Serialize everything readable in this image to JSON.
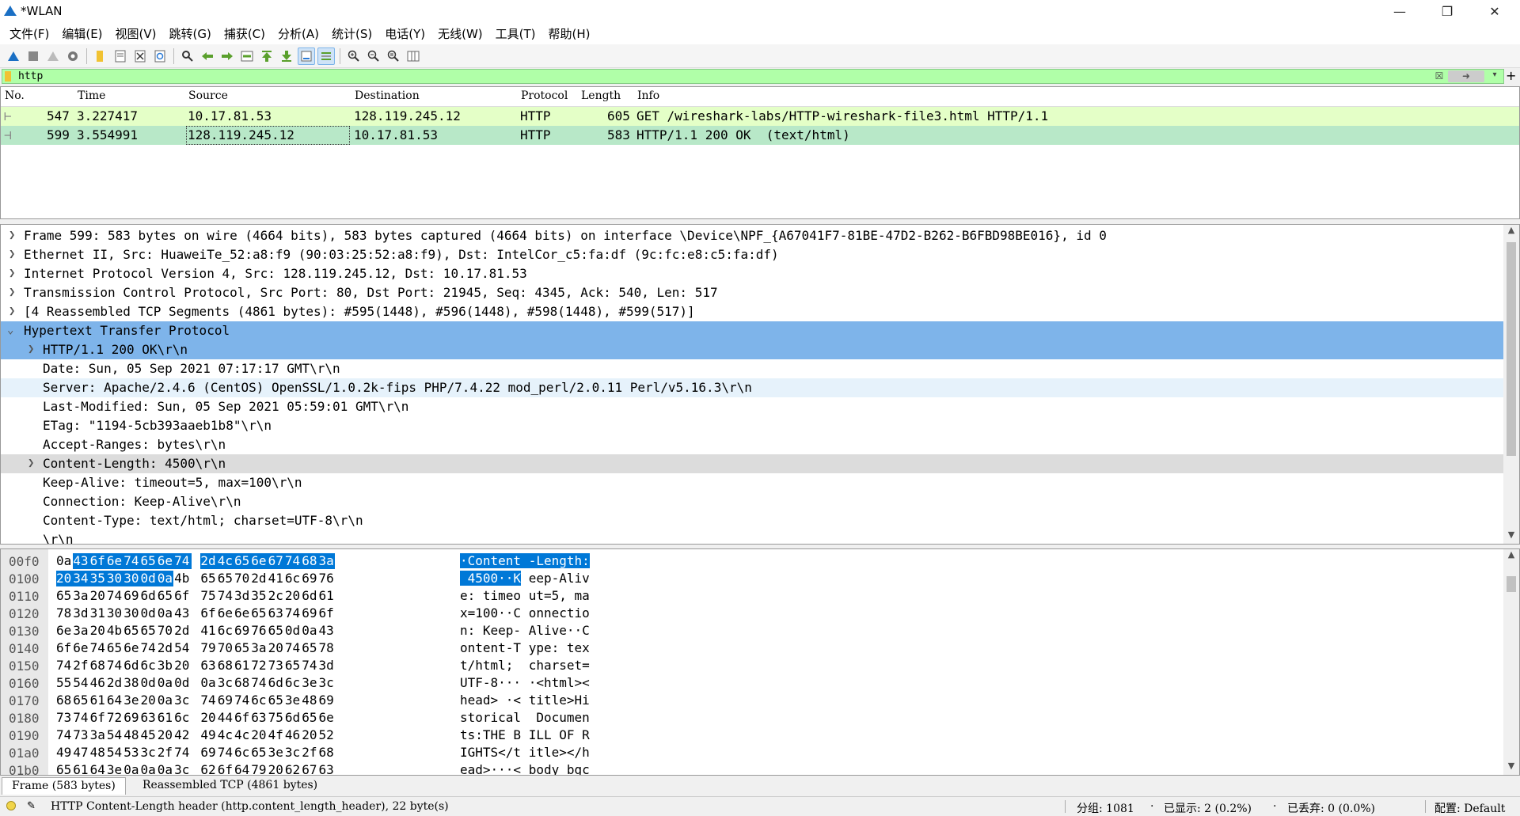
{
  "window": {
    "title": "*WLAN"
  },
  "menu": [
    "文件(F)",
    "编辑(E)",
    "视图(V)",
    "跳转(G)",
    "捕获(C)",
    "分析(A)",
    "统计(S)",
    "电话(Y)",
    "无线(W)",
    "工具(T)",
    "帮助(H)"
  ],
  "filter": {
    "value": "http"
  },
  "packet_list": {
    "columns": [
      "No.",
      "Time",
      "Source",
      "Destination",
      "Protocol",
      "Length",
      "Info"
    ],
    "rows": [
      {
        "no": "547",
        "time": "3.227417",
        "source": "10.17.81.53",
        "destination": "128.119.245.12",
        "protocol": "HTTP",
        "length": "605",
        "info": "GET /wireshark-labs/HTTP-wireshark-file3.html HTTP/1.1"
      },
      {
        "no": "599",
        "time": "3.554991",
        "source": "128.119.245.12",
        "destination": "10.17.81.53",
        "protocol": "HTTP",
        "length": "583",
        "info": "HTTP/1.1 200 OK  (text/html)"
      }
    ]
  },
  "details": [
    {
      "text": "Frame 599: 583 bytes on wire (4664 bits), 583 bytes captured (4664 bits) on interface \\Device\\NPF_{A67041F7-81BE-47D2-B262-B6FBD98BE016}, id 0"
    },
    {
      "text": "Ethernet II, Src: HuaweiTe_52:a8:f9 (90:03:25:52:a8:f9), Dst: IntelCor_c5:fa:df (9c:fc:e8:c5:fa:df)"
    },
    {
      "text": "Internet Protocol Version 4, Src: 128.119.245.12, Dst: 10.17.81.53"
    },
    {
      "text": "Transmission Control Protocol, Src Port: 80, Dst Port: 21945, Seq: 4345, Ack: 540, Len: 517"
    },
    {
      "text": "[4 Reassembled TCP Segments (4861 bytes): #595(1448), #596(1448), #598(1448), #599(517)]"
    },
    {
      "text": "Hypertext Transfer Protocol"
    },
    {
      "text": "HTTP/1.1 200 OK\\r\\n"
    },
    {
      "text": "Date: Sun, 05 Sep 2021 07:17:17 GMT\\r\\n"
    },
    {
      "text": "Server: Apache/2.4.6 (CentOS) OpenSSL/1.0.2k-fips PHP/7.4.22 mod_perl/2.0.11 Perl/v5.16.3\\r\\n"
    },
    {
      "text": "Last-Modified: Sun, 05 Sep 2021 05:59:01 GMT\\r\\n"
    },
    {
      "text": "ETag: \"1194-5cb393aaeb1b8\"\\r\\n"
    },
    {
      "text": "Accept-Ranges: bytes\\r\\n"
    },
    {
      "text": "Content-Length: 4500\\r\\n"
    },
    {
      "text": "Keep-Alive: timeout=5, max=100\\r\\n"
    },
    {
      "text": "Connection: Keep-Alive\\r\\n"
    },
    {
      "text": "Content-Type: text/html; charset=UTF-8\\r\\n"
    },
    {
      "text": "\\r\\n"
    }
  ],
  "hex": [
    {
      "off": "00f0",
      "bytes": [
        "0a",
        "43",
        "6f",
        "6e",
        "74",
        "65",
        "6e",
        "74",
        "2d",
        "4c",
        "65",
        "6e",
        "67",
        "74",
        "68",
        "3a"
      ],
      "ascii": "·Content -Length:"
    },
    {
      "off": "0100",
      "bytes": [
        "20",
        "34",
        "35",
        "30",
        "30",
        "0d",
        "0a",
        "4b",
        "65",
        "65",
        "70",
        "2d",
        "41",
        "6c",
        "69",
        "76"
      ],
      "ascii": " 4500··K eep-Aliv"
    },
    {
      "off": "0110",
      "bytes": [
        "65",
        "3a",
        "20",
        "74",
        "69",
        "6d",
        "65",
        "6f",
        "75",
        "74",
        "3d",
        "35",
        "2c",
        "20",
        "6d",
        "61"
      ],
      "ascii": "e: timeo ut=5, ma"
    },
    {
      "off": "0120",
      "bytes": [
        "78",
        "3d",
        "31",
        "30",
        "30",
        "0d",
        "0a",
        "43",
        "6f",
        "6e",
        "6e",
        "65",
        "63",
        "74",
        "69",
        "6f"
      ],
      "ascii": "x=100··C onnectio"
    },
    {
      "off": "0130",
      "bytes": [
        "6e",
        "3a",
        "20",
        "4b",
        "65",
        "65",
        "70",
        "2d",
        "41",
        "6c",
        "69",
        "76",
        "65",
        "0d",
        "0a",
        "43"
      ],
      "ascii": "n: Keep- Alive··C"
    },
    {
      "off": "0140",
      "bytes": [
        "6f",
        "6e",
        "74",
        "65",
        "6e",
        "74",
        "2d",
        "54",
        "79",
        "70",
        "65",
        "3a",
        "20",
        "74",
        "65",
        "78"
      ],
      "ascii": "ontent-T ype: tex"
    },
    {
      "off": "0150",
      "bytes": [
        "74",
        "2f",
        "68",
        "74",
        "6d",
        "6c",
        "3b",
        "20",
        "63",
        "68",
        "61",
        "72",
        "73",
        "65",
        "74",
        "3d"
      ],
      "ascii": "t/html;  charset="
    },
    {
      "off": "0160",
      "bytes": [
        "55",
        "54",
        "46",
        "2d",
        "38",
        "0d",
        "0a",
        "0d",
        "0a",
        "3c",
        "68",
        "74",
        "6d",
        "6c",
        "3e",
        "3c"
      ],
      "ascii": "UTF-8··· ·<html><"
    },
    {
      "off": "0170",
      "bytes": [
        "68",
        "65",
        "61",
        "64",
        "3e",
        "20",
        "0a",
        "3c",
        "74",
        "69",
        "74",
        "6c",
        "65",
        "3e",
        "48",
        "69"
      ],
      "ascii": "head> ·< title>Hi"
    },
    {
      "off": "0180",
      "bytes": [
        "73",
        "74",
        "6f",
        "72",
        "69",
        "63",
        "61",
        "6c",
        "20",
        "44",
        "6f",
        "63",
        "75",
        "6d",
        "65",
        "6e"
      ],
      "ascii": "storical  Documen"
    },
    {
      "off": "0190",
      "bytes": [
        "74",
        "73",
        "3a",
        "54",
        "48",
        "45",
        "20",
        "42",
        "49",
        "4c",
        "4c",
        "20",
        "4f",
        "46",
        "20",
        "52"
      ],
      "ascii": "ts:THE B ILL OF R"
    },
    {
      "off": "01a0",
      "bytes": [
        "49",
        "47",
        "48",
        "54",
        "53",
        "3c",
        "2f",
        "74",
        "69",
        "74",
        "6c",
        "65",
        "3e",
        "3c",
        "2f",
        "68"
      ],
      "ascii": "IGHTS</t itle></h"
    },
    {
      "off": "01b0",
      "bytes": [
        "65",
        "61",
        "64",
        "3e",
        "0a",
        "0a",
        "0a",
        "3c",
        "62",
        "6f",
        "64",
        "79",
        "20",
        "62",
        "67",
        "63"
      ],
      "ascii": "ead>···< body bgc"
    }
  ],
  "byte_tabs": [
    "Frame (583 bytes)",
    "Reassembled TCP (4861 bytes)"
  ],
  "status": {
    "field": "HTTP Content-Length header (http.content_length_header), 22 byte(s)",
    "packets": "分组: 1081",
    "displayed": "已显示: 2 (0.2%)",
    "dropped": "已丢弃: 0 (0.0%)",
    "profile": "配置: Default"
  }
}
